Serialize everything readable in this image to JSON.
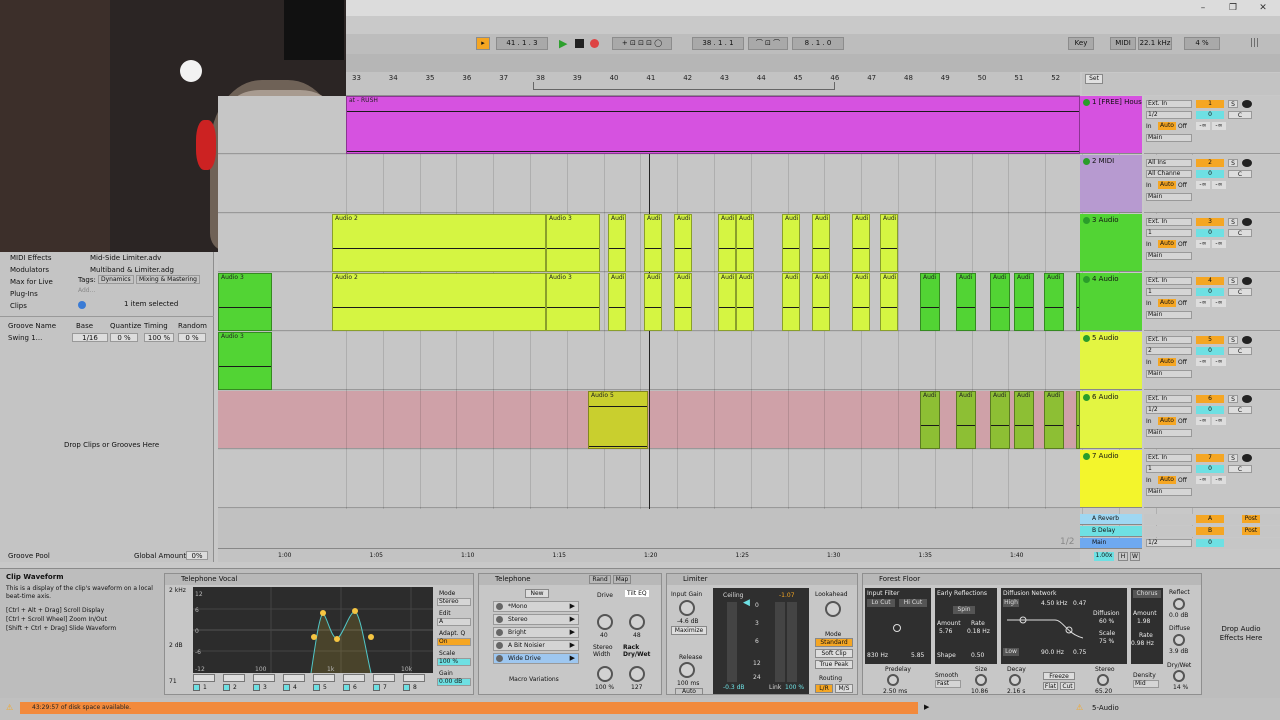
{
  "window": {
    "minimize": "–",
    "maximize": "❐",
    "close": "✕"
  },
  "transport": {
    "tempo_pos": "41 . 1 . 3",
    "arrangement_pos": "38 . 1 . 1",
    "loop_len": "8 . 1 . 0",
    "key_label": "Key",
    "midi_label": "MIDI",
    "sample_rate": "22.1 kHz",
    "cpu": "4 %"
  },
  "ruler": {
    "bars": [
      "33",
      "34",
      "35",
      "36",
      "37",
      "38",
      "39",
      "40",
      "41",
      "42",
      "43",
      "44",
      "45",
      "46",
      "47",
      "48",
      "49",
      "50",
      "51",
      "52"
    ],
    "set_label": "Set"
  },
  "time_ruler": [
    "1:00",
    "1:05",
    "1:10",
    "1:15",
    "1:20",
    "1:25",
    "1:30",
    "1:35",
    "1:40"
  ],
  "fraction": "1/2",
  "browser": {
    "categories": [
      "MIDI Effects",
      "Modulators",
      "Max for Live",
      "Plug-Ins",
      "Clips"
    ],
    "files": [
      "Mid-Side Limiter.adv",
      "Multiband & Limiter.adg"
    ],
    "tags_label": "Tags:",
    "tags": [
      "Dynamics",
      "Mixing & Mastering"
    ],
    "add_label": "Add...",
    "selected": "1 item selected",
    "groove_headers": [
      "Groove Name",
      "Base",
      "Quantize",
      "Timing",
      "Random"
    ],
    "groove_row": {
      "name": "Swing 1...",
      "base": "1/16",
      "quantize": "0 %",
      "timing": "100 %",
      "random": "0 %"
    },
    "drop_text": "Drop Clips or Grooves Here",
    "groove_pool": "Groove Pool",
    "global_amount_label": "Global Amount",
    "global_amount": "0%"
  },
  "tracks": [
    {
      "name": "1 [FREE] Hous",
      "color": "#d652e0",
      "num": "1",
      "input": "Ext. In",
      "channel": "1/2",
      "out": "Main"
    },
    {
      "name": "2 MIDI",
      "color": "#b79ad0",
      "num": "2",
      "input": "All Ins",
      "channel": "All Channe",
      "out": "Main"
    },
    {
      "name": "3 Audio",
      "color": "#52d434",
      "num": "3",
      "input": "Ext. In",
      "channel": "1",
      "out": "Main"
    },
    {
      "name": "4 Audio",
      "color": "#52d434",
      "num": "4",
      "input": "Ext. In",
      "channel": "1",
      "out": "Main"
    },
    {
      "name": "5 Audio",
      "color": "#e3f542",
      "num": "5",
      "input": "Ext. In",
      "channel": "2",
      "out": "Main"
    },
    {
      "name": "6 Audio",
      "color": "#e3f542",
      "num": "6",
      "input": "Ext. In",
      "channel": "1/2",
      "out": "Main"
    },
    {
      "name": "7 Audio",
      "color": "#f3f52c",
      "num": "7",
      "input": "Ext. In",
      "channel": "1",
      "out": "Main"
    }
  ],
  "returns": [
    {
      "name": "A Reverb",
      "letter": "A",
      "color": "#9fd7f2"
    },
    {
      "name": "B Delay",
      "letter": "B",
      "color": "#6ee0e3"
    },
    {
      "name": "Main",
      "letter": "",
      "color": "#6ea9f0"
    }
  ],
  "main_channel": "1/2",
  "main_zoom": "1.00x",
  "mix_labels": {
    "in": "In",
    "auto": "Auto",
    "off": "Off",
    "inf": "-∞",
    "c": "C",
    "s": "S",
    "post": "Post",
    "zero": "0",
    "h": "H",
    "w": "W"
  },
  "clips": {
    "track1": "at - RUSH",
    "audio2": "Audio 2",
    "audio3": "Audio 3",
    "audio5": "Audio 5",
    "audio": "Audi",
    "short_a": "A"
  },
  "info": {
    "title": "Clip Waveform",
    "body": "This is a display of the clip's waveform on a local beat-time axis.",
    "hint1": "[Ctrl + Alt + Drag] Scroll Display",
    "hint2": "[Ctrl + Scroll Wheel] Zoom In/Out",
    "hint3": "[Shift + Ctrl + Drag] Slide Waveform"
  },
  "eq": {
    "title": "Telephone Vocal",
    "y_ticks": [
      "12",
      "6",
      "0",
      "-6",
      "-12"
    ],
    "x_ticks": [
      "100",
      "1k",
      "10k"
    ],
    "mode_label": "Mode",
    "mode": "Stereo",
    "edit_label": "Edit",
    "edit": "A",
    "adapt_label": "Adapt. Q",
    "adapt": "On",
    "scale_label": "Scale",
    "scale": "100 %",
    "gain_label": "Gain",
    "gain": "0.00 dB",
    "side_vals": [
      "2 kHz",
      "2 dB",
      "71"
    ],
    "bands": [
      "1",
      "2",
      "3",
      "4",
      "5",
      "6",
      "7",
      "8"
    ]
  },
  "telephone": {
    "title": "Telephone",
    "new_label": "New",
    "rand_label": "Rand",
    "map_label": "Map",
    "chains": [
      "*Mono",
      "Stereo",
      "Bright",
      "A Bit Noisier",
      "Wide Drive"
    ],
    "drive_label": "Drive",
    "drive_val": "40",
    "tilt_label": "Tilt EQ",
    "tilt_val": "48",
    "width_label": "Stereo Width",
    "width_val": "100 %",
    "rack_label": "Rack Dry/Wet",
    "rack_val": "127",
    "macro_variations": "Macro Variations"
  },
  "limiter": {
    "title": "Limiter",
    "input_gain_label": "Input Gain",
    "input_gain": "-4.6 dB",
    "maximize": "Maximize",
    "release_label": "Release",
    "release": "100 ms",
    "auto": "Auto",
    "ceiling_label": "Ceiling",
    "ceiling": "-1.07",
    "meter_ticks": [
      "0",
      "3",
      "6",
      "12",
      "24"
    ],
    "meter_val": "-0.3 dB",
    "link_label": "Link",
    "link": "100 %",
    "lookahead_label": "Lookahead",
    "mode_label": "Mode",
    "modes": [
      "Standard",
      "Soft Clip",
      "True Peak"
    ],
    "routing_label": "Routing",
    "routing": [
      "L/R",
      "M/S"
    ]
  },
  "reverb": {
    "title": "Forest Floor",
    "input_filter": "Input Filter",
    "lo_cut": "Lo Cut",
    "hi_cut": "Hi Cut",
    "freq1": "830 Hz",
    "freq2": "5.85",
    "early": "Early Reflections",
    "spin": "Spin",
    "amount_label": "Amount",
    "amount": "5.76",
    "rate_label": "Rate",
    "rate": "0.18 Hz",
    "shape_label": "Shape",
    "shape": "0.50",
    "diffusion": "Diffusion Network",
    "high": "High",
    "hf": "4.50 kHz",
    "hf_val": "0.47",
    "low": "Low",
    "lf": "90.0 Hz",
    "lf_val": "0.75",
    "diffusion_label": "Diffusion",
    "diffusion_val": "60 %",
    "scale_label": "Scale",
    "scale_val": "75 %",
    "chorus": "Chorus",
    "chorus_amount_label": "Amount",
    "chorus_amount": "1.98",
    "chorus_rate_label": "Rate",
    "chorus_rate": "0.98 Hz",
    "predelay_label": "Predelay",
    "predelay": "2.50 ms",
    "smooth_label": "Smooth",
    "smooth": "Fast",
    "size_label": "Size",
    "size": "10.86",
    "decay_label": "Decay",
    "decay": "2.16 s",
    "freeze": "Freeze",
    "flat": "Flat",
    "cut": "Cut",
    "stereo_label": "Stereo",
    "stereo": "65.20",
    "density_label": "Density",
    "density": "Mid",
    "reflect_label": "Reflect",
    "reflect": "0.0 dB",
    "diffuse_label": "Diffuse",
    "diffuse": "3.9 dB",
    "drywet_label": "Dry/Wet",
    "drywet": "14 %"
  },
  "drop_effects": "Drop Audio Effects Here",
  "status": {
    "text": "43:29:57 of disk space available.",
    "track": "5-Audio"
  }
}
